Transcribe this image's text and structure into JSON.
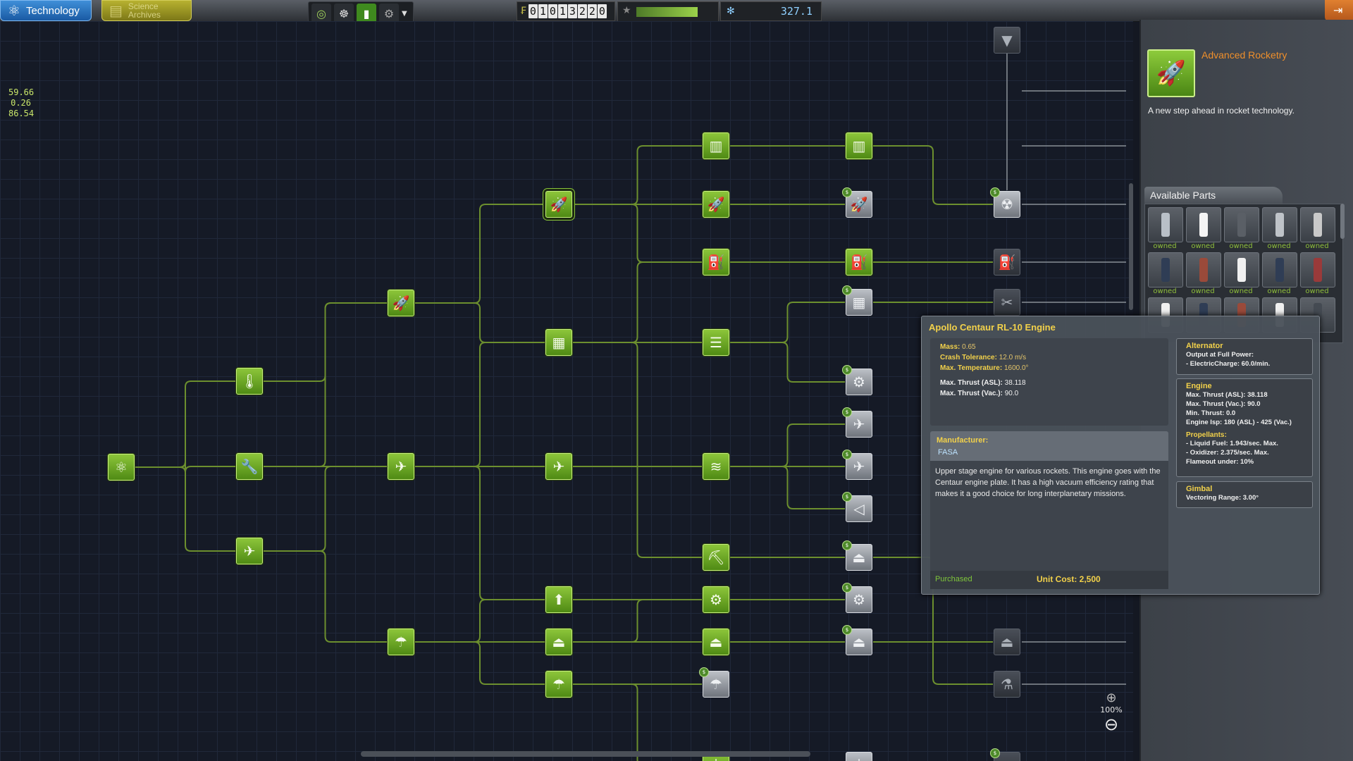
{
  "topbar": {
    "tab_technology": "Technology",
    "tab_archives_line1": "Science",
    "tab_archives_line2": "Archives",
    "tools": [
      "globe-icon",
      "career-icon",
      "strategy-icon",
      "settings-icon"
    ],
    "funds_digits": [
      "0",
      "1",
      "0",
      "1",
      "3",
      "2",
      "2",
      "0"
    ],
    "reputation_fraction": 0.78,
    "science_value": "327.1"
  },
  "coords": {
    "x": "59.66",
    "y": "0.26",
    "z": "86.54"
  },
  "zoom": {
    "label": "100%"
  },
  "tech_panel": {
    "title": "Advanced Rocketry",
    "description": "A new step ahead in rocket technology.",
    "parts_header": "Available Parts",
    "owned_label": "owned",
    "colors": {
      "accent": "#ef8f2b",
      "researched": "#6aa824",
      "gold": "#f2d14a"
    }
  },
  "tooltip": {
    "title": "Apollo Centaur RL-10 Engine",
    "stats": [
      {
        "k": "Mass:",
        "v": "0.65"
      },
      {
        "k": "Crash Tolerance:",
        "v": "12.0 m/s"
      },
      {
        "k": "Max. Temperature:",
        "v": "1600.0°"
      }
    ],
    "thrust": [
      {
        "k": "Max. Thrust (ASL):",
        "v": "38.118"
      },
      {
        "k": "Max. Thrust (Vac.):",
        "v": "90.0"
      }
    ],
    "manufacturer_label": "Manufacturer:",
    "manufacturer": "FASA",
    "description": "Upper stage engine for various rockets. This engine goes with the Centaur engine plate. It has a high vacuum efficiency rating that makes it a good choice for long interplanetary missions.",
    "status": "Purchased",
    "unit_cost": "Unit Cost: 2,500",
    "modules": [
      {
        "title": "Alternator",
        "lines": [
          "Output at Full Power:",
          "- ElectricCharge: 60.0/min."
        ]
      },
      {
        "title": "Engine",
        "lines": [
          "Max. Thrust (ASL): 38.118",
          "Max. Thrust (Vac.): 90.0",
          "Min. Thrust: 0.0",
          "Engine Isp: 180 (ASL) - 425 (Vac.)"
        ],
        "subhead": "Propellants:",
        "sublines": [
          "- Liquid Fuel: 1.943/sec. Max.",
          "- Oxidizer: 2.375/sec. Max.",
          "Flameout under: 10%"
        ]
      },
      {
        "title": "Gimbal",
        "lines": [
          "Vectoring Range: 3.00°"
        ]
      }
    ]
  },
  "tree_nodes": [
    {
      "name": "start",
      "state": "res",
      "glyph": "⚛"
    },
    {
      "name": "basic-rocketry",
      "state": "res",
      "glyph": "🌡"
    },
    {
      "name": "engineering-101",
      "state": "res",
      "glyph": "🔧"
    },
    {
      "name": "basic-aviation",
      "state": "res",
      "glyph": "✈"
    },
    {
      "name": "general-rocketry",
      "state": "res",
      "glyph": "🚀"
    },
    {
      "name": "stability",
      "state": "res",
      "glyph": "✈"
    },
    {
      "name": "survivability",
      "state": "res",
      "glyph": "☂"
    },
    {
      "name": "advanced-rocketry",
      "state": "res",
      "glyph": "🚀"
    },
    {
      "name": "general-construction",
      "state": "res",
      "glyph": "▦"
    },
    {
      "name": "aviation",
      "state": "res",
      "glyph": "✈"
    },
    {
      "name": "landing",
      "state": "res",
      "glyph": "⬆"
    },
    {
      "name": "basic-science",
      "state": "res",
      "glyph": "⏏"
    },
    {
      "name": "flight-control",
      "state": "res",
      "glyph": "☂"
    },
    {
      "name": "heavy-rocketry",
      "state": "res",
      "glyph": "▥"
    },
    {
      "name": "propulsion-systems",
      "state": "res",
      "glyph": "🚀"
    },
    {
      "name": "fuel-systems",
      "state": "res",
      "glyph": "⛽"
    },
    {
      "name": "adv-construction",
      "state": "res",
      "glyph": "☰"
    },
    {
      "name": "aerodynamics",
      "state": "res",
      "glyph": "≋"
    },
    {
      "name": "miniaturization",
      "state": "res",
      "glyph": "⛏"
    },
    {
      "name": "adv-flight-control",
      "state": "res",
      "glyph": "⚙"
    },
    {
      "name": "space-exploration",
      "state": "res",
      "glyph": "⏏"
    },
    {
      "name": "adv-landing",
      "state": "avail",
      "glyph": "☂"
    },
    {
      "name": "electrics",
      "state": "res",
      "glyph": "⏚"
    },
    {
      "name": "heavier-rocketry",
      "state": "res",
      "glyph": "▥"
    },
    {
      "name": "precision-propulsion",
      "state": "avail",
      "glyph": "🚀"
    },
    {
      "name": "adv-fuel-systems",
      "state": "res",
      "glyph": "⛽"
    },
    {
      "name": "specialized-construction",
      "state": "avail",
      "glyph": "▦"
    },
    {
      "name": "actuators",
      "state": "avail",
      "glyph": "⚙"
    },
    {
      "name": "supersonic-flight",
      "state": "avail",
      "glyph": "✈"
    },
    {
      "name": "high-altitude",
      "state": "avail",
      "glyph": "✈"
    },
    {
      "name": "heavy-aerodynamics",
      "state": "avail",
      "glyph": "◁"
    },
    {
      "name": "field-science",
      "state": "avail",
      "glyph": "⏏"
    },
    {
      "name": "specialized-control",
      "state": "avail",
      "glyph": "⚙"
    },
    {
      "name": "command-modules",
      "state": "avail",
      "glyph": "⏏"
    },
    {
      "name": "adv-electrics",
      "state": "avail",
      "glyph": "⏚"
    },
    {
      "name": "nuclear-propulsion",
      "state": "avail",
      "glyph": "☢"
    },
    {
      "name": "fuel-tanks",
      "state": "dim",
      "glyph": "⛽"
    },
    {
      "name": "metamaterials",
      "state": "dim",
      "glyph": "✂"
    },
    {
      "name": "adv-exploration",
      "state": "dim",
      "glyph": "⏏"
    },
    {
      "name": "adv-science",
      "state": "dim",
      "glyph": "⚗"
    },
    {
      "name": "adv-unmanned",
      "state": "dim",
      "glyph": "▱"
    },
    {
      "name": "top-hidden",
      "state": "dim",
      "glyph": "▼"
    }
  ],
  "parts_grid": [
    {
      "color": "#b9c0c8",
      "owned": true
    },
    {
      "color": "#f4f4f4",
      "owned": true
    },
    {
      "color": "#5a5f66",
      "owned": true
    },
    {
      "color": "#bfc3c8",
      "owned": true
    },
    {
      "color": "#c9c9c9",
      "owned": true
    },
    {
      "color": "#2f3d55",
      "owned": true
    },
    {
      "color": "#9a4a3a",
      "owned": true
    },
    {
      "color": "#f0f0f0",
      "owned": true
    },
    {
      "color": "#2f3d55",
      "owned": true
    },
    {
      "color": "#9a3a3a",
      "owned": true
    },
    {
      "color": "#f0f0f0",
      "owned": false
    },
    {
      "color": "#2f3d55",
      "owned": false
    },
    {
      "color": "#9a4a3a",
      "owned": false
    },
    {
      "color": "#f0f0f0",
      "owned": false
    },
    {
      "color": "#444a52",
      "owned": false
    }
  ]
}
